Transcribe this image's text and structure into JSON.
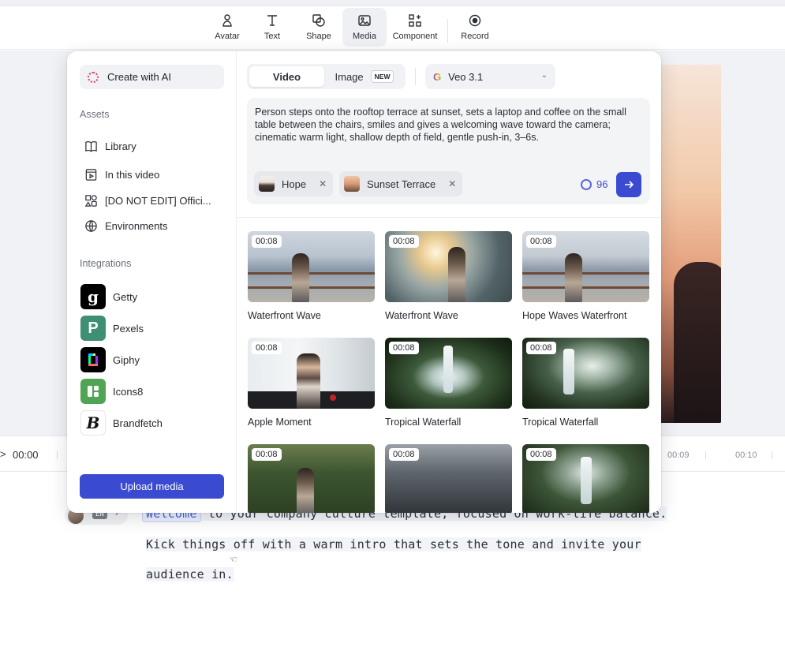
{
  "toolbar": {
    "items": [
      {
        "label": "Avatar",
        "icon": "avatar-icon"
      },
      {
        "label": "Text",
        "icon": "text-icon"
      },
      {
        "label": "Shape",
        "icon": "shape-icon"
      },
      {
        "label": "Media",
        "icon": "media-icon",
        "active": true
      },
      {
        "label": "Component",
        "icon": "component-icon"
      },
      {
        "label": "Record",
        "icon": "record-icon"
      }
    ]
  },
  "panel": {
    "create_ai": "Create with AI",
    "assets_title": "Assets",
    "assets": [
      {
        "label": "Library",
        "icon": "book-icon"
      },
      {
        "label": "In this video",
        "icon": "video-file-icon"
      },
      {
        "label": "[DO NOT EDIT] Offici...",
        "icon": "shapes-icon"
      },
      {
        "label": "Environments",
        "icon": "globe-icon"
      }
    ],
    "integrations_title": "Integrations",
    "integrations": [
      {
        "label": "Getty",
        "glyph": "g",
        "color": "#000000"
      },
      {
        "label": "Pexels",
        "glyph": "P",
        "color": "#3f8f75"
      },
      {
        "label": "Giphy",
        "glyph": "▮",
        "color": "#000000"
      },
      {
        "label": "Icons8",
        "glyph": "▚",
        "color": "#4fa553"
      },
      {
        "label": "Brandfetch",
        "glyph": "B",
        "color": "#ffffff"
      }
    ],
    "upload_label": "Upload media"
  },
  "generator": {
    "tab_video": "Video",
    "tab_image": "Image",
    "new_badge": "NEW",
    "model": "Veo 3.1",
    "model_logo": "G",
    "prompt": "Person steps onto the rooftop terrace at sunset, sets a laptop and coffee on the small table between the chairs, smiles and gives a welcoming wave toward the camera; cinematic warm light, shallow depth of field, gentle push-in, 3–6s.",
    "chip_avatar": "Hope",
    "chip_env": "Sunset Terrace",
    "credits": "96",
    "send_icon": "arrow-right-icon"
  },
  "results": [
    {
      "duration": "00:08",
      "title": "Waterfront Wave",
      "scene": "waterfront"
    },
    {
      "duration": "00:08",
      "title": "Waterfront Wave",
      "scene": "sunwater"
    },
    {
      "duration": "00:08",
      "title": "Hope Waves Waterfront",
      "scene": "waterfront"
    },
    {
      "duration": "00:08",
      "title": "Apple Moment",
      "scene": "office"
    },
    {
      "duration": "00:08",
      "title": "Tropical Waterfall",
      "scene": "waterfall"
    },
    {
      "duration": "00:08",
      "title": "Tropical Waterfall",
      "scene": "waterfall2"
    },
    {
      "duration": "00:08",
      "title": "",
      "scene": "jungle"
    },
    {
      "duration": "00:08",
      "title": "",
      "scene": "scifi"
    },
    {
      "duration": "00:08",
      "title": "",
      "scene": "waterfall3"
    }
  ],
  "timeline": {
    "current": "00:00",
    "marks": [
      "00:09",
      "00:10"
    ]
  },
  "script": {
    "language": "EN",
    "line1_tag": "Welcome",
    "line1_rest": " to your company culture template, focused on work-life balance.",
    "line2": "Kick things off with a warm intro that sets the tone and invite your",
    "line3": "audience in."
  }
}
